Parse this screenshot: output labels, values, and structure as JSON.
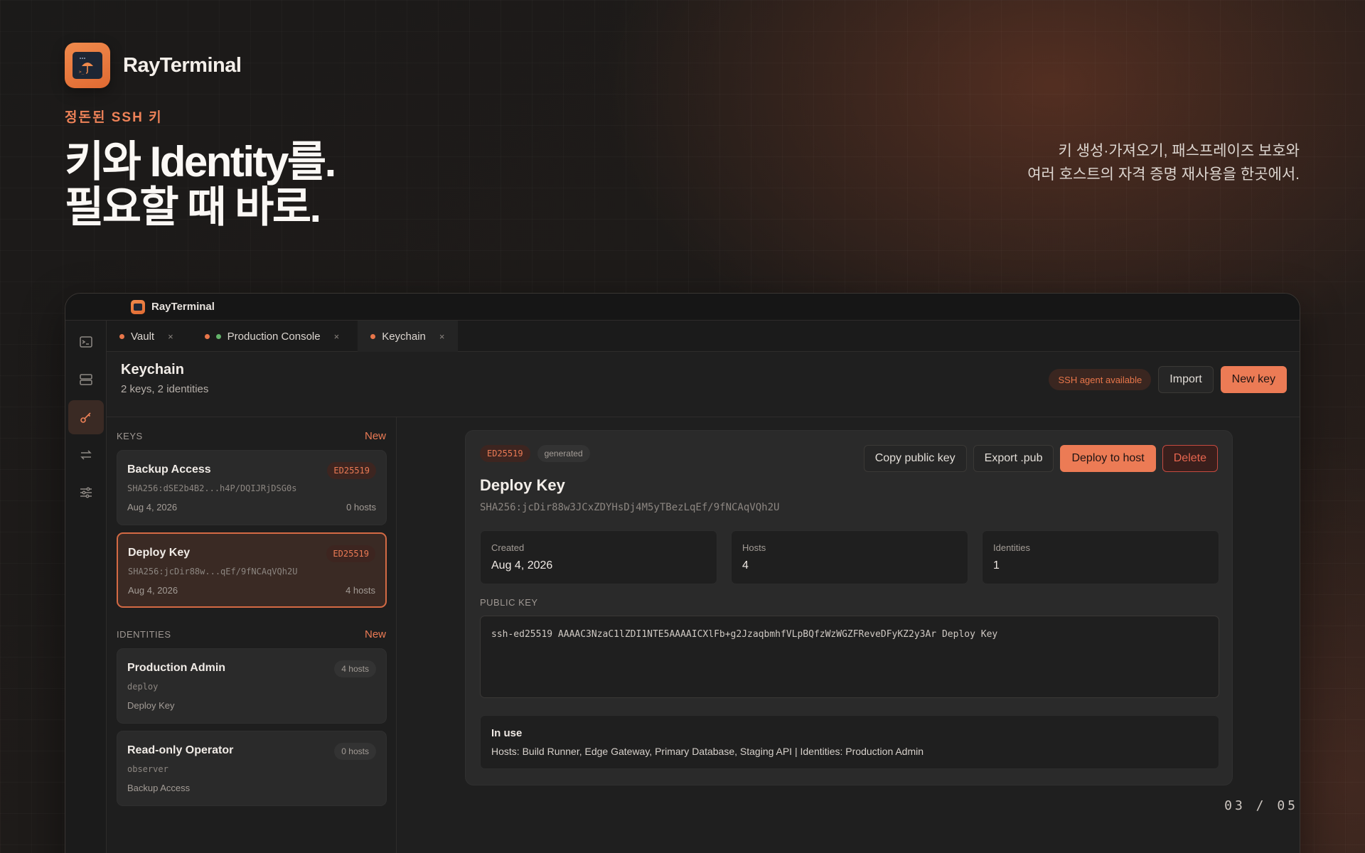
{
  "brand": {
    "name": "RayTerminal"
  },
  "hero": {
    "eyebrow": "정돈된 SSH 키",
    "headline_line1": "키와 Identity를.",
    "headline_line2": "필요할 때 바로.",
    "tagline_line1": "키 생성·가져오기, 패스프레이즈 보호와",
    "tagline_line2": "여러 호스트의 자격 증명 재사용을 한곳에서."
  },
  "slide": {
    "page": "03 / 05"
  },
  "window": {
    "title": "RayTerminal",
    "rail": [
      {
        "icon": "terminal-icon",
        "active": false
      },
      {
        "icon": "server-icon",
        "active": false
      },
      {
        "icon": "key-icon",
        "active": true
      },
      {
        "icon": "transfer-icon",
        "active": false
      },
      {
        "icon": "sliders-icon",
        "active": false
      }
    ],
    "tabs": [
      {
        "label": "Vault",
        "close": "×"
      },
      {
        "label": "Production Console",
        "close": "×"
      },
      {
        "label": "Keychain",
        "close": "×"
      }
    ],
    "header": {
      "title": "Keychain",
      "subtitle": "2 keys, 2 identities",
      "agent_status": "SSH agent available",
      "import_label": "Import",
      "new_key_label": "New key"
    },
    "keys_section": {
      "label": "KEYS",
      "new_label": "New",
      "items": [
        {
          "name": "Backup Access",
          "type": "ED25519",
          "fingerprint": "SHA256:dSE2b4B2...h4P/DQIJRjDSG0s",
          "date": "Aug 4, 2026",
          "hosts": "0 hosts"
        },
        {
          "name": "Deploy Key",
          "type": "ED25519",
          "fingerprint": "SHA256:jcDir88w...qEf/9fNCAqVQh2U",
          "date": "Aug 4, 2026",
          "hosts": "4 hosts"
        }
      ]
    },
    "identities_section": {
      "label": "IDENTITIES",
      "new_label": "New",
      "items": [
        {
          "name": "Production Admin",
          "hosts": "4 hosts",
          "username": "deploy",
          "key": "Deploy Key"
        },
        {
          "name": "Read-only Operator",
          "hosts": "0 hosts",
          "username": "observer",
          "key": "Backup Access"
        }
      ]
    },
    "detail": {
      "type_badge": "ED25519",
      "origin_badge": "generated",
      "copy_label": "Copy public key",
      "export_label": "Export .pub",
      "deploy_label": "Deploy to host",
      "delete_label": "Delete",
      "title": "Deploy Key",
      "fingerprint": "SHA256:jcDir88w3JCxZDYHsDj4M5yTBezLqEf/9fNCAqVQh2U",
      "stats": [
        {
          "label": "Created",
          "value": "Aug 4, 2026"
        },
        {
          "label": "Hosts",
          "value": "4"
        },
        {
          "label": "Identities",
          "value": "1"
        }
      ],
      "public_key_label": "PUBLIC KEY",
      "public_key": "ssh-ed25519 AAAAC3NzaC1lZDI1NTE5AAAAICXlFb+g2JzaqbmhfVLpBQfzWzWGZFReveDFyKZ2y3Ar Deploy Key",
      "in_use_title": "In use",
      "in_use_text": "Hosts: Build Runner, Edge Gateway, Primary Database, Staging API | Identities: Production Admin"
    }
  }
}
